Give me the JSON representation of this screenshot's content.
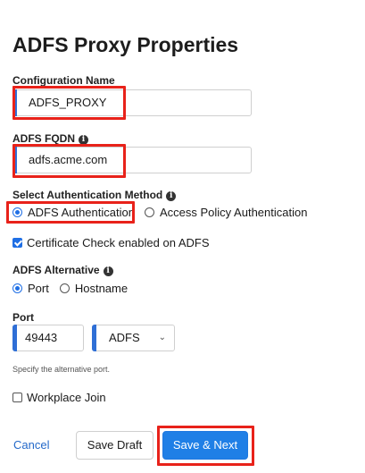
{
  "page": {
    "title": "ADFS Proxy Properties"
  },
  "config_name": {
    "label": "Configuration Name",
    "value": "ADFS_PROXY"
  },
  "fqdn": {
    "label": "ADFS FQDN",
    "value": "adfs.acme.com",
    "info_icon": "info-icon"
  },
  "auth_method": {
    "label": "Select Authentication Method",
    "options": [
      "ADFS Authentication",
      "Access Policy Authentication"
    ],
    "selected": "ADFS Authentication"
  },
  "cert_check": {
    "label": "Certificate Check enabled on ADFS",
    "checked": true
  },
  "alternative": {
    "label": "ADFS Alternative",
    "options": [
      "Port",
      "Hostname"
    ],
    "selected": "Port"
  },
  "port": {
    "label": "Port",
    "value": "49443",
    "select_value": "ADFS",
    "hint": "Specify the alternative port."
  },
  "workplace_join": {
    "label": "Workplace Join",
    "checked": false
  },
  "actions": {
    "cancel": "Cancel",
    "save_draft": "Save Draft",
    "save_next": "Save & Next"
  },
  "colors": {
    "accent": "#1f7fe6",
    "highlight": "#e8221a",
    "field_bar": "#2f6fd6",
    "link": "#2469c9"
  }
}
